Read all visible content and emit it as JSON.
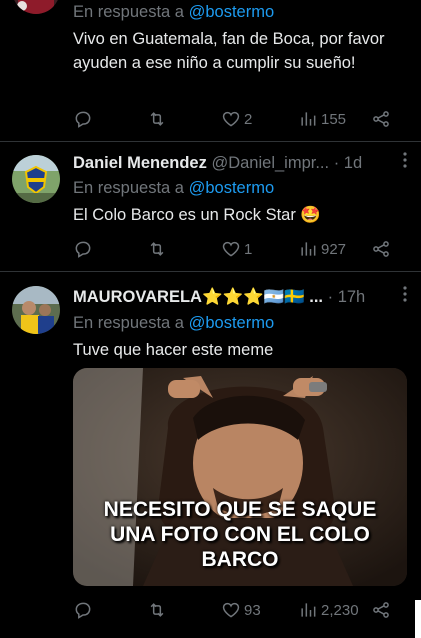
{
  "tweets": [
    {
      "reply_prefix": "En respuesta a",
      "reply_to": "@bostermo",
      "text": "Vivo en Guatemala,  fan de Boca, por favor ayuden a ese niño a cumplir su sueño!",
      "likes": "2",
      "views": "155"
    },
    {
      "name": "Daniel Menendez",
      "handle": "@Daniel_impr...",
      "separator": "·",
      "time": "1d",
      "reply_prefix": "En respuesta a",
      "reply_to": "@bostermo",
      "text": "El Colo Barco es un Rock Star 🤩",
      "likes": "1",
      "views": "927"
    },
    {
      "name": "MAUROVARELA⭐⭐⭐🇦🇷🇸🇪 ...",
      "separator": "·",
      "time": "17h",
      "reply_prefix": "En respuesta a",
      "reply_to": "@bostermo",
      "text": "Tuve que hacer este meme",
      "meme_caption_line1": "NECESITO QUE SE SAQUE",
      "meme_caption_line2": "UNA FOTO CON EL COLO BARCO",
      "likes": "93",
      "views": "2,230"
    }
  ],
  "icons": {
    "reply": "reply-icon",
    "retweet": "retweet-icon",
    "like": "heart-icon",
    "views": "views-icon",
    "share": "share-icon",
    "more": "more-icon"
  },
  "colors": {
    "background": "#000000",
    "text": "#e7e9ea",
    "muted": "#71767b",
    "mention": "#1d9bf0",
    "divider": "#2f3336"
  }
}
